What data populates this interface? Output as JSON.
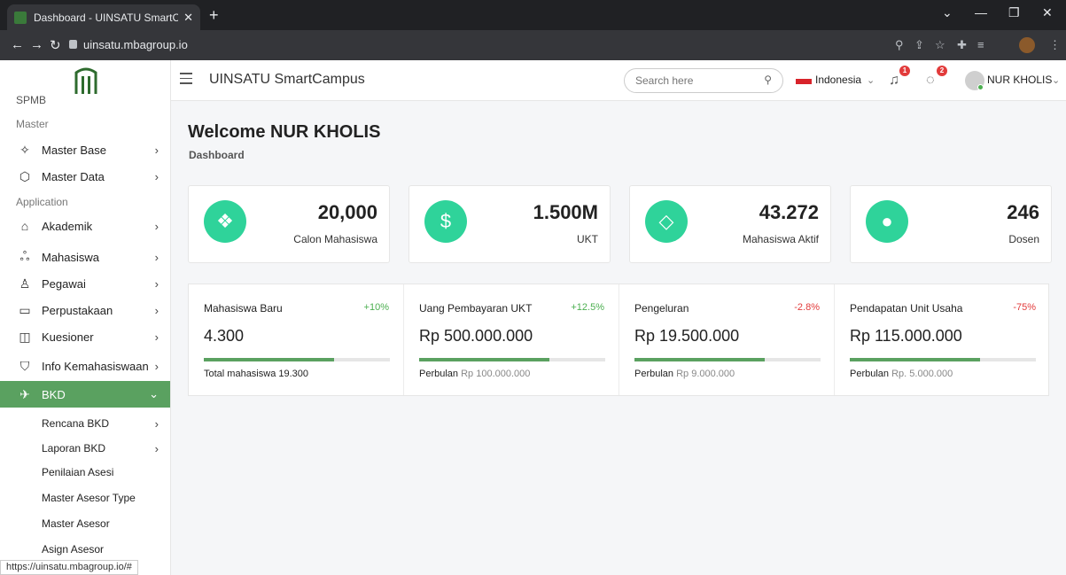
{
  "browser": {
    "tab_title": "Dashboard - UINSATU SmartCam",
    "new_tab": "+",
    "url": "uinsatu.mbagroup.io",
    "status_url": "https://uinsatu.mbagroup.io/#"
  },
  "sidebar": {
    "cut_item": "SPMB",
    "master_label": "Master",
    "application_label": "Application",
    "items": [
      {
        "label": "Master Base",
        "icon": "puzzle-icon"
      },
      {
        "label": "Master Data",
        "icon": "cube-icon"
      },
      {
        "label": "Akademik",
        "icon": "graduation-cap-icon"
      },
      {
        "label": "Mahasiswa",
        "icon": "users-icon"
      },
      {
        "label": "Pegawai",
        "icon": "user-icon"
      },
      {
        "label": "Perpustakaan",
        "icon": "book-icon"
      },
      {
        "label": "Kuesioner",
        "icon": "layout-icon"
      },
      {
        "label": "Info Kemahasiswaan",
        "icon": "shield-icon"
      },
      {
        "label": "BKD",
        "icon": "rocket-icon",
        "active": true
      }
    ],
    "sub_items": [
      {
        "label": "Rencana BKD",
        "chevron": true
      },
      {
        "label": "Laporan BKD",
        "chevron": true
      },
      {
        "label": "Penilaian Asesi",
        "chevron": false
      },
      {
        "label": "Master Asesor Type",
        "chevron": false
      },
      {
        "label": "Master Asesor",
        "chevron": false
      },
      {
        "label": "Asign Asesor",
        "chevron": false
      }
    ]
  },
  "header": {
    "title": "UINSATU SmartCampus",
    "search_placeholder": "Search here",
    "language": "Indonesia",
    "notif_count": "1",
    "message_count": "2",
    "user_name": "NUR KHOLIS"
  },
  "main": {
    "welcome": "Welcome NUR KHOLIS",
    "breadcrumb": "Dashboard",
    "stats": [
      {
        "value": "20,000",
        "label": "Calon Mahasiswa",
        "icon": "boxes-icon"
      },
      {
        "value": "1.500M",
        "label": "UKT",
        "icon": "dollar-icon"
      },
      {
        "value": "43.272",
        "label": "Mahasiswa Aktif",
        "icon": "diamond-icon"
      },
      {
        "value": "246",
        "label": "Dosen",
        "icon": "person-icon"
      }
    ],
    "summary": [
      {
        "name": "Mahasiswa Baru",
        "pct": "+10%",
        "trend": "up",
        "amount": "4.300",
        "progress": 0.7,
        "foot_label": "Total mahasiswa 19.300",
        "foot_value": ""
      },
      {
        "name": "Uang Pembayaran UKT",
        "pct": "+12.5%",
        "trend": "up",
        "amount": "Rp 500.000.000",
        "progress": 0.7,
        "foot_label": "Perbulan",
        "foot_value": "Rp 100.000.000"
      },
      {
        "name": "Pengeluran",
        "pct": "-2.8%",
        "trend": "down",
        "amount": "Rp 19.500.000",
        "progress": 0.7,
        "foot_label": "Perbulan",
        "foot_value": "Rp 9.000.000"
      },
      {
        "name": "Pendapatan Unit Usaha",
        "pct": "-75%",
        "trend": "down",
        "amount": "Rp 115.000.000",
        "progress": 0.7,
        "foot_label": "Perbulan",
        "foot_value": "Rp. 5.000.000"
      }
    ]
  },
  "colors": {
    "accent": "#2fd39a",
    "sidebar_active": "#5aa160",
    "up": "#4caf50",
    "down": "#e23b3b"
  }
}
